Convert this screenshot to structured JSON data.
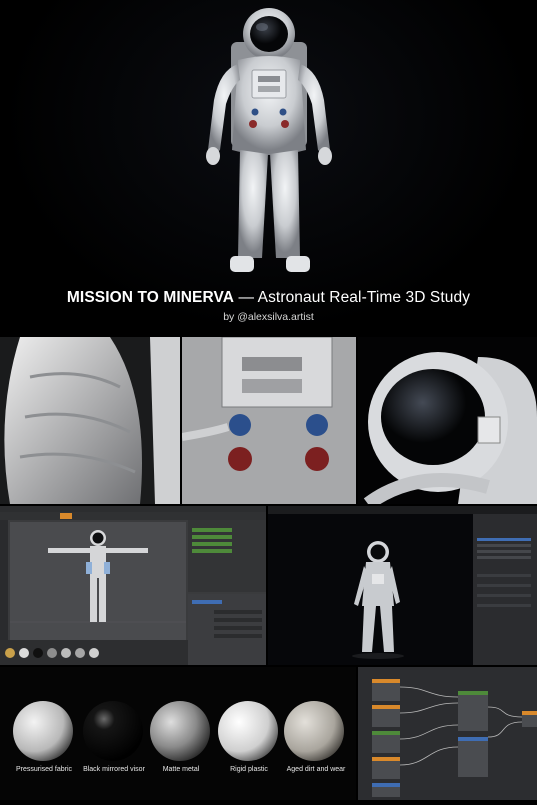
{
  "hero": {
    "title_bold": "MISSION TO MINERVA",
    "title_rest": " — Astronaut Real-Time 3D Study",
    "byline": "by @alexsilva.artist"
  },
  "details": [
    {
      "name": "sleeve-closeup"
    },
    {
      "name": "chest-control-box-closeup"
    },
    {
      "name": "helmet-visor-closeup"
    }
  ],
  "materials": [
    {
      "label": "Pressurised fabric",
      "color": "#cfcfcf"
    },
    {
      "label": "Black mirrored visor",
      "color": "#111111"
    },
    {
      "label": "Matte metal",
      "color": "#9a9a9a"
    },
    {
      "label": "Rigid plastic",
      "color": "#e4e4e4"
    },
    {
      "label": "Aged dirt and wear",
      "color": "#bdb9b1"
    }
  ],
  "colors": {
    "accent_orange": "#d9892b",
    "node_green": "#4e8a3a",
    "node_blue": "#3f6db3",
    "node_grey": "#5c5e62"
  }
}
